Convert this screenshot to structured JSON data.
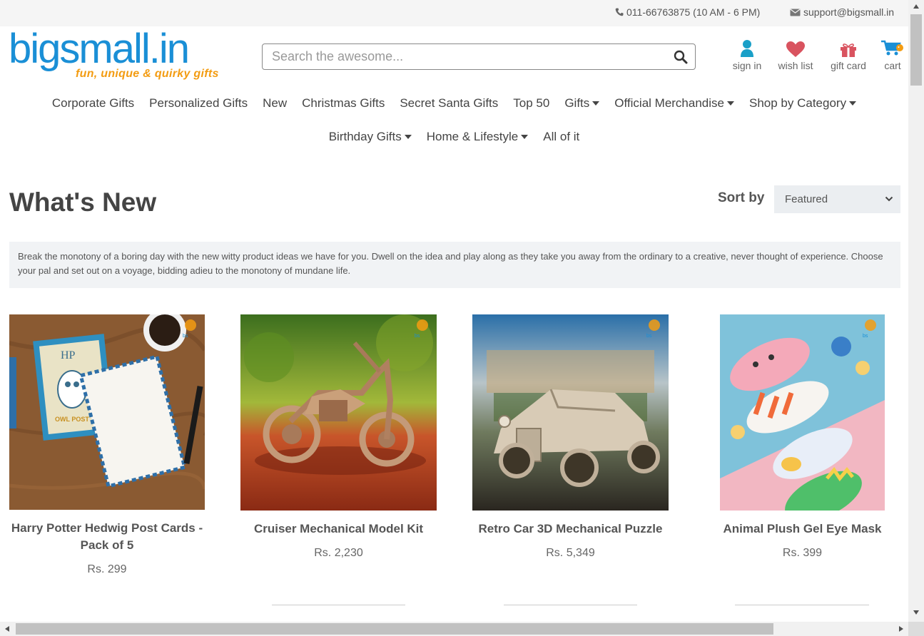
{
  "topbar": {
    "phone": "011-66763875 (10 AM - 6 PM)",
    "email": "support@bigsmall.in"
  },
  "logo": {
    "main": "bigsmall.in",
    "tagline": "fun, unique & quirky gifts"
  },
  "search": {
    "placeholder": "Search the awesome..."
  },
  "header_icons": {
    "signin": "sign in",
    "wishlist": "wish list",
    "giftcard": "gift card",
    "cart": "cart"
  },
  "nav": {
    "row1": [
      {
        "label": "Corporate Gifts"
      },
      {
        "label": "Personalized Gifts"
      },
      {
        "label": "New"
      },
      {
        "label": "Christmas Gifts"
      },
      {
        "label": "Secret Santa Gifts"
      },
      {
        "label": "Top 50"
      },
      {
        "label": "Gifts"
      },
      {
        "label": "Official Merchandise"
      },
      {
        "label": "Shop by Category"
      }
    ],
    "row2": [
      {
        "label": "Birthday Gifts"
      },
      {
        "label": "Home & Lifestyle"
      },
      {
        "label": "All of it"
      }
    ]
  },
  "page": {
    "title": "What's New",
    "sort_label": "Sort by",
    "sort_value": "Featured",
    "description": "Break the monotony of a boring day with the new witty product ideas we have for you. Dwell on the idea and play along as they take you away from the ordinary to a creative, never thought of experience. Choose your pal and set out on a voyage, bidding adieu to the monotony of mundane life."
  },
  "products": [
    {
      "name": "Harry Potter Hedwig Post Cards - Pack of 5",
      "price": "Rs. 299",
      "card_text_1": "HP",
      "card_text_2": "OWL POST"
    },
    {
      "name": "Cruiser Mechanical Model Kit",
      "price": "Rs. 2,230"
    },
    {
      "name": "Retro Car 3D Mechanical Puzzle",
      "price": "Rs. 5,349"
    },
    {
      "name": "Animal Plush Gel Eye Mask",
      "price": "Rs. 399"
    }
  ],
  "colors": {
    "brand_blue": "#1a8fd6",
    "brand_orange": "#f39c12",
    "signin_icon": "#1aa0c8",
    "wishlist_icon": "#d9535f",
    "giftcard_icon": "#d9535f"
  }
}
